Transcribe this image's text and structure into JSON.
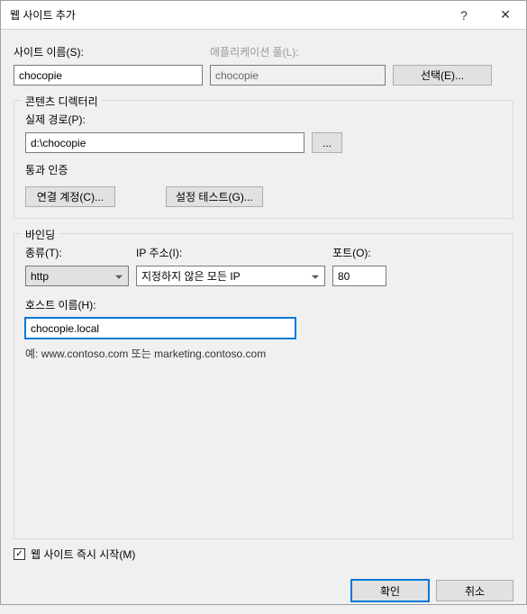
{
  "titlebar": {
    "title": "웹 사이트 추가",
    "help": "?",
    "close": "✕"
  },
  "site_name_label": "사이트 이름(S):",
  "site_name_value": "chocopie",
  "app_pool_label": "애플리케이션 풀(L):",
  "app_pool_value": "chocopie",
  "select_button": "선택(E)...",
  "content_dir_group": "콘텐츠 디렉터리",
  "physical_path_label": "실제 경로(P):",
  "physical_path_value": "d:\\chocopie",
  "browse_button": "...",
  "passthrough_label": "통과 인증",
  "connect_as_button": "연결 계정(C)...",
  "test_settings_button": "설정 테스트(G)...",
  "binding_group": "바인딩",
  "type_label": "종류(T):",
  "type_value": "http",
  "ip_label": "IP 주소(I):",
  "ip_value": "지정하지 않은 모든 IP",
  "port_label": "포트(O):",
  "port_value": "80",
  "host_label": "호스트 이름(H):",
  "host_value": "chocopie.local",
  "example_text": "예: www.contoso.com 또는 marketing.contoso.com",
  "start_immediately_label": "웹 사이트 즉시 시작(M)",
  "start_immediately_checked": true,
  "ok_button": "확인",
  "cancel_button": "취소"
}
